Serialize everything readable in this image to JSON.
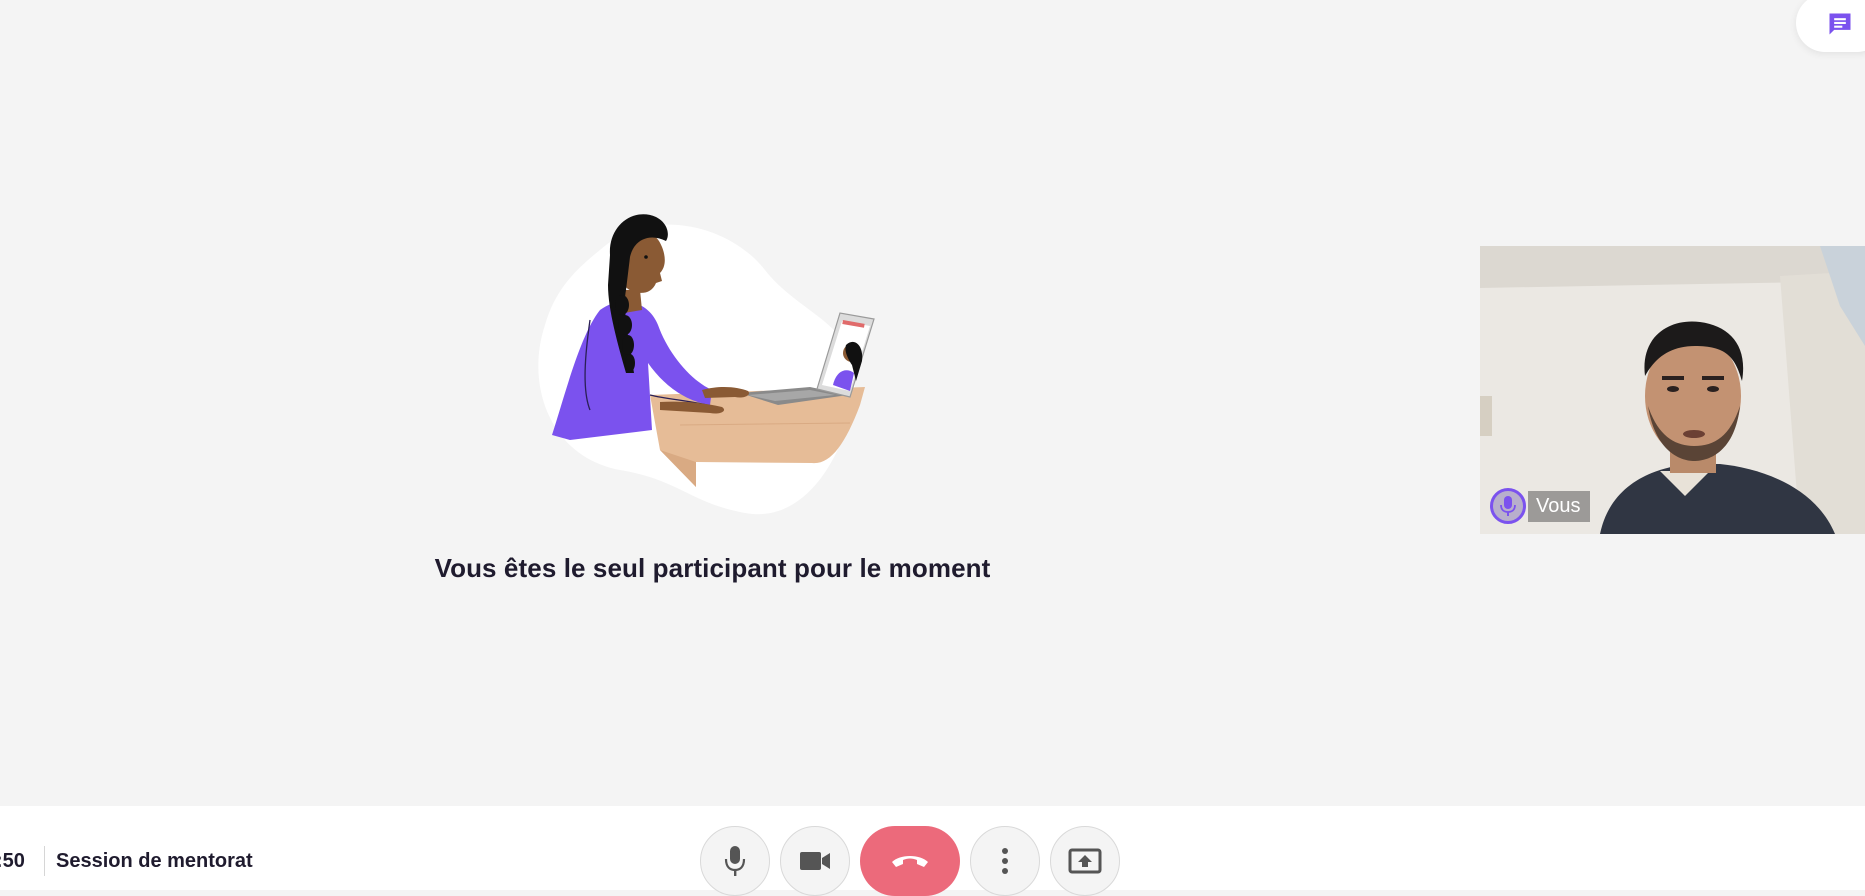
{
  "chat": {
    "icon": "chat-bubble-icon",
    "accent_color": "#7b52ee"
  },
  "main": {
    "empty_message": "Vous êtes le seul participant pour le moment",
    "illustration": "woman-on-video-call-illustration"
  },
  "self_view": {
    "label": "Vous",
    "mic_icon": "microphone-icon",
    "ring_color": "#7b52ee"
  },
  "footer": {
    "timer": ":50",
    "session_title": "Session de mentorat",
    "controls": [
      {
        "name": "microphone-button",
        "icon": "microphone-icon"
      },
      {
        "name": "camera-button",
        "icon": "video-camera-icon"
      },
      {
        "name": "hang-up-button",
        "icon": "phone-hangup-icon",
        "color": "#ec6a7b"
      },
      {
        "name": "more-options-button",
        "icon": "more-vertical-icon"
      },
      {
        "name": "share-screen-button",
        "icon": "screen-share-icon"
      }
    ]
  }
}
